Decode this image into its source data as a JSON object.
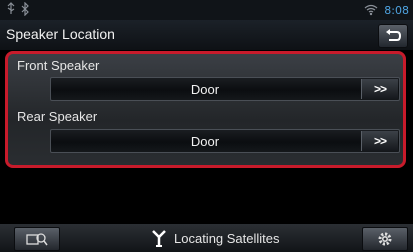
{
  "status": {
    "time": "8:08"
  },
  "header": {
    "title": "Speaker Location"
  },
  "speakers": [
    {
      "label": "Front Speaker",
      "value": "Door",
      "button_label": ">>"
    },
    {
      "label": "Rear Speaker",
      "value": "Door",
      "button_label": ">>"
    }
  ],
  "footer": {
    "status_text": "Locating Satellites"
  },
  "icons": {
    "status_left": [
      "usb-icon",
      "bluetooth-icon"
    ],
    "status_right": [
      "wifi-signal-icon"
    ],
    "back": "back-arrow-icon",
    "footer_left": "screen-adjust-icon",
    "footer_center": "gps-antenna-icon",
    "footer_right": "settings-gear-icon"
  },
  "colors": {
    "accent_border": "#c81b2b",
    "clock": "#4ea3e0"
  }
}
